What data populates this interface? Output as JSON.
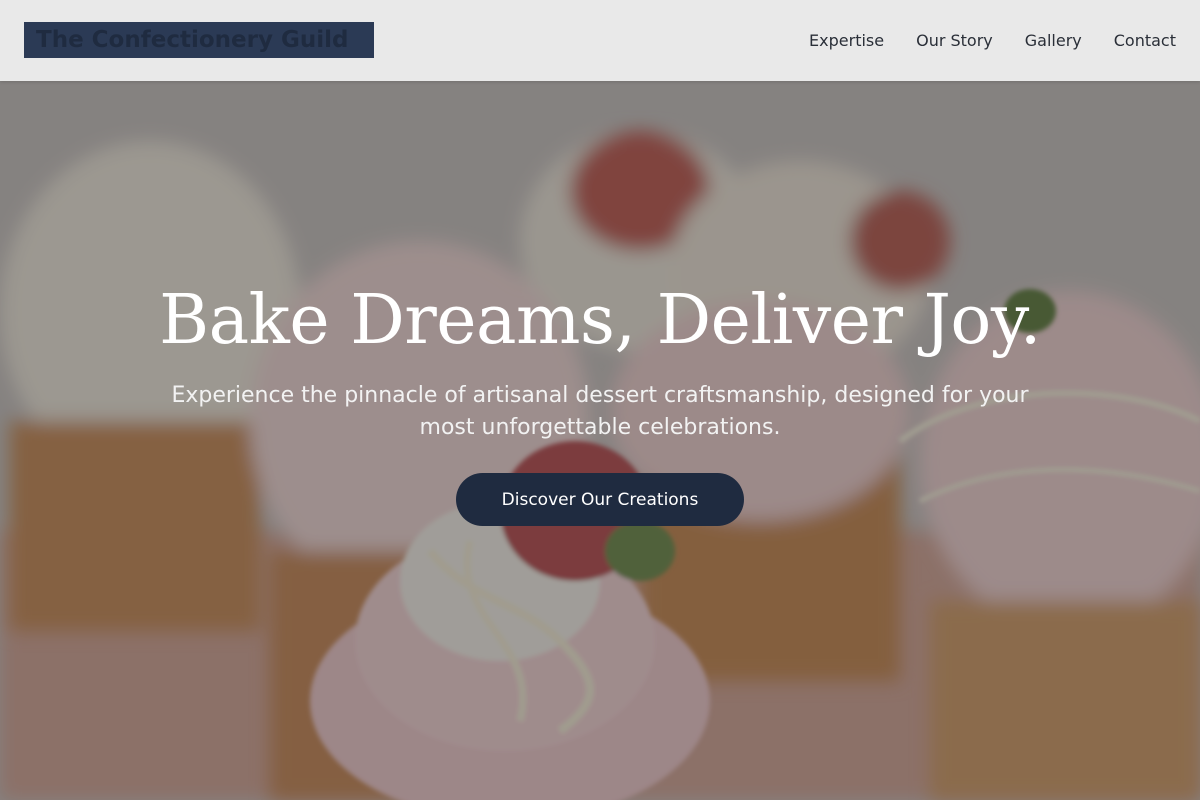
{
  "brand": {
    "name": "The Confectionery Guild"
  },
  "nav": {
    "items": [
      {
        "label": "Expertise"
      },
      {
        "label": "Our Story"
      },
      {
        "label": "Gallery"
      },
      {
        "label": "Contact"
      }
    ]
  },
  "hero": {
    "title": "Bake Dreams, Deliver Joy.",
    "subtitle": "Experience the pinnacle of artisanal dessert craftsmanship, designed for your most unforgettable celebrations.",
    "cta_label": "Discover Our Creations",
    "background_image": "cupcakes-with-strawberries-photo"
  },
  "colors": {
    "header_bg": "#e9e9e9",
    "brand_dark": "#1f2b40",
    "text_light": "#ffffff"
  }
}
